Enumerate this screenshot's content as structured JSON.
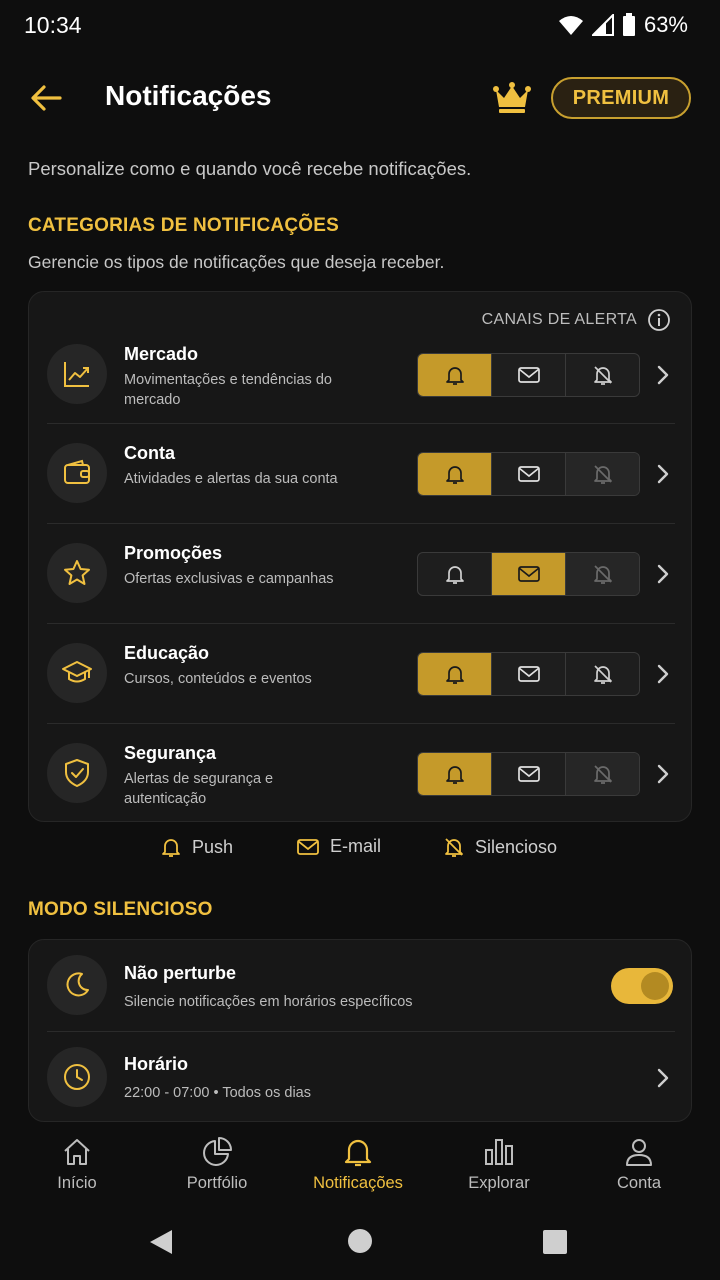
{
  "status": {
    "time": "10:34",
    "battery": "63%"
  },
  "header": {
    "title": "Notificações",
    "premium": "PREMIUM"
  },
  "intro": "Personalize como e quando você recebe notificações.",
  "categories": {
    "title": "CATEGORIAS DE NOTIFICAÇÕES",
    "subtitle": "Gerencie os tipos de notificações que deseja receber.",
    "channels_label": "CANAIS DE ALERTA",
    "items": [
      {
        "name": "Mercado",
        "desc": "Movimentações e tendências do mercado",
        "icon": "chart-line-icon",
        "push": true,
        "email": false,
        "silent": false
      },
      {
        "name": "Conta",
        "desc": "Atividades e alertas da sua conta",
        "icon": "wallet-icon",
        "push": true,
        "email": false,
        "silent": false
      },
      {
        "name": "Promoções",
        "desc": "Ofertas exclusivas e campanhas",
        "icon": "star-icon",
        "push": false,
        "email": true,
        "silent": false
      },
      {
        "name": "Educação",
        "desc": "Cursos, conteúdos e eventos",
        "icon": "graduation-cap-icon",
        "push": true,
        "email": false,
        "silent": false
      },
      {
        "name": "Segurança",
        "desc": "Alertas de segurança e autenticação",
        "icon": "shield-check-icon",
        "push": true,
        "email": false,
        "silent": false
      }
    ]
  },
  "legend": {
    "push": "Push",
    "email": "E-mail",
    "silent": "Silencioso"
  },
  "silent_mode": {
    "title": "MODO SILENCIOSO",
    "dnd_title": "Não perturbe",
    "dnd_desc": "Silencie notificações em horários específicos",
    "dnd_enabled": true,
    "schedule_title": "Horário",
    "schedule_value": "22:00 - 07:00 • Todos os dias"
  },
  "nav": [
    {
      "label": "Início",
      "icon": "home-icon"
    },
    {
      "label": "Portfólio",
      "icon": "pie-chart-icon"
    },
    {
      "label": "Notificações",
      "icon": "bell-icon",
      "active": true
    },
    {
      "label": "Explorar",
      "icon": "bar-chart-icon"
    },
    {
      "label": "Conta",
      "icon": "user-icon"
    }
  ],
  "colors": {
    "accent": "#f0c040",
    "accent_fill": "#c59a2a",
    "background": "#0e0e0e",
    "card": "#171717"
  }
}
